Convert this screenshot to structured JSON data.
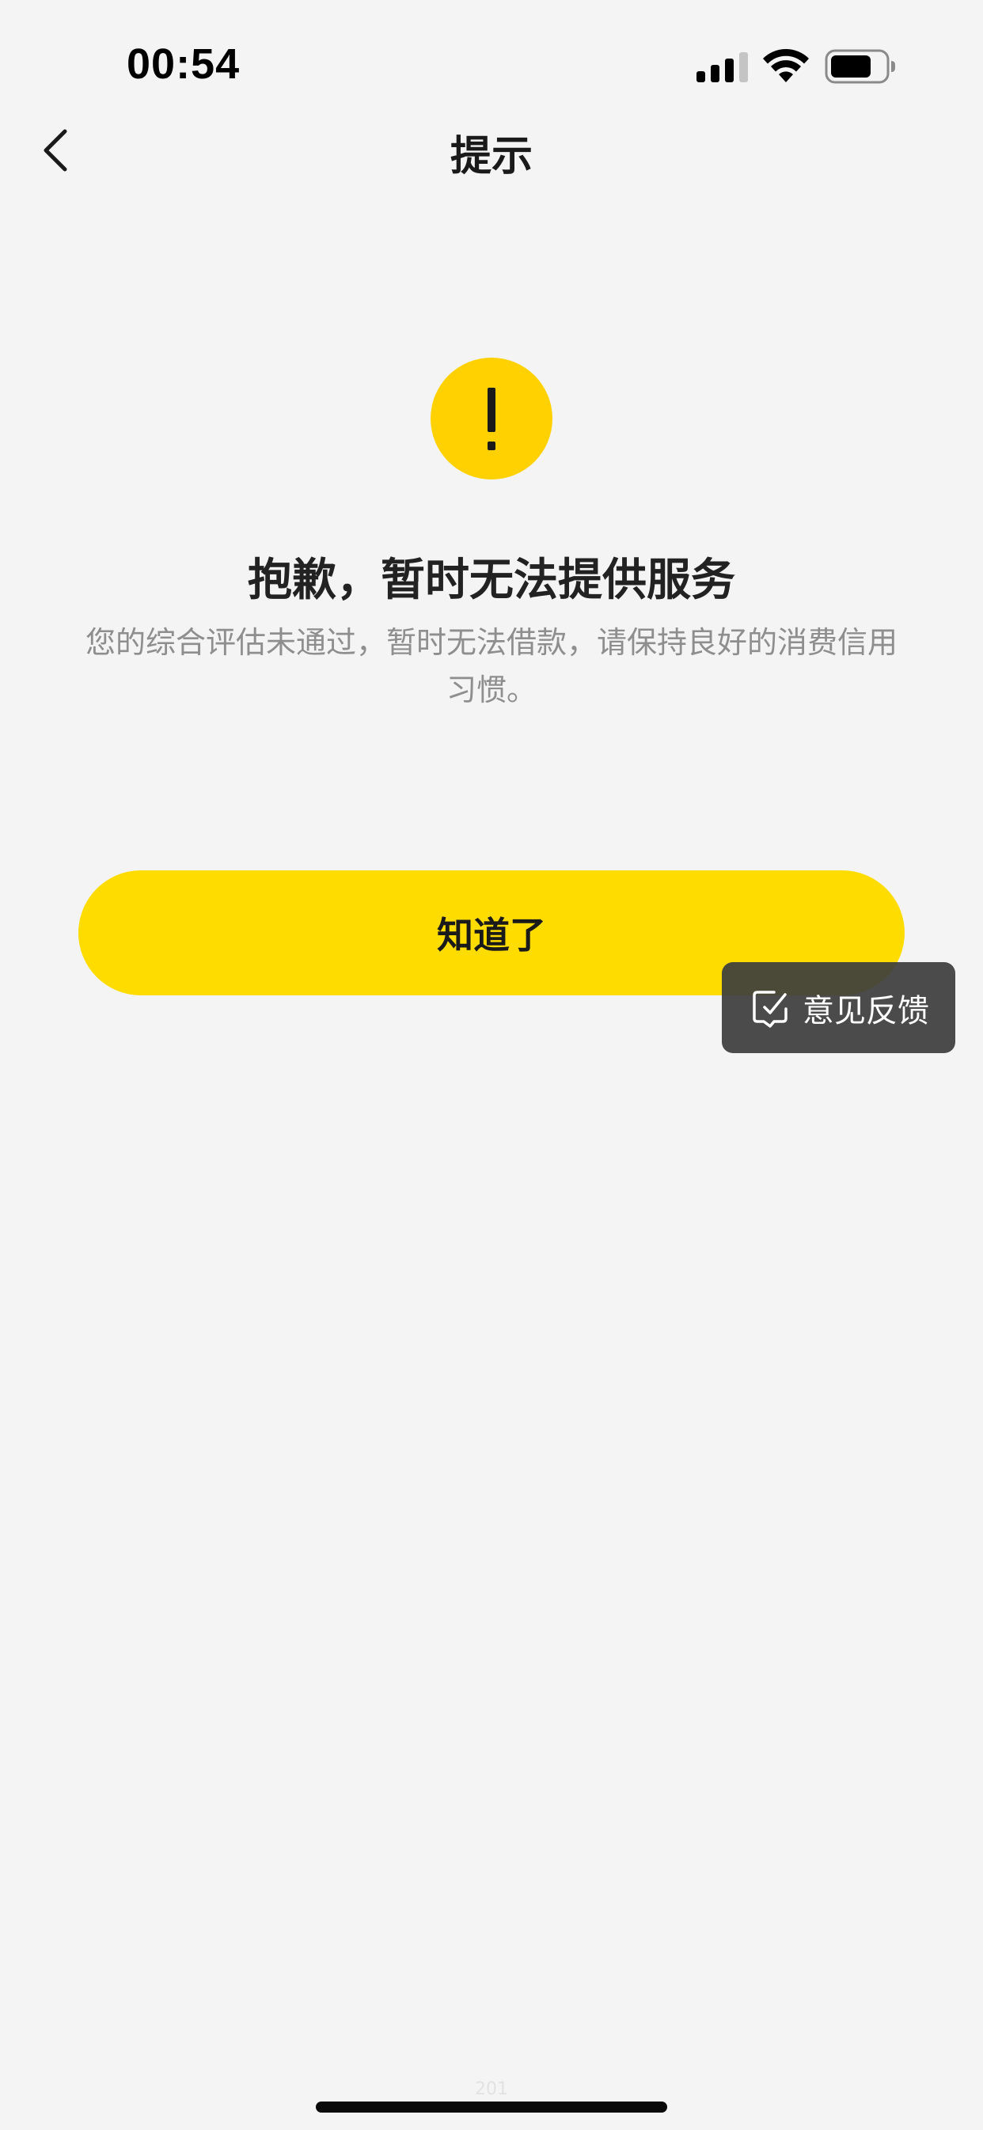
{
  "status_bar": {
    "time": "00:54"
  },
  "nav": {
    "title": "提示"
  },
  "result": {
    "icon_glyph": "!",
    "title": "抱歉，暂时无法提供服务",
    "description": "您的综合评估未通过，暂时无法借款，请保持良好的消费信用习惯。"
  },
  "actions": {
    "confirm_label": "知道了"
  },
  "feedback": {
    "label": "意见反馈"
  },
  "footer": {
    "code": "201"
  },
  "colors": {
    "accent_yellow": "#ffdc00",
    "warning_yellow": "#ffd100",
    "background": "#f4f4f4",
    "feedback_bg": "#3c3c3c"
  },
  "icons": {
    "back": "chevron-left-icon",
    "signal": "cellular-signal-icon",
    "wifi": "wifi-icon",
    "battery": "battery-icon",
    "warning": "exclamation-icon",
    "feedback": "feedback-chat-icon"
  }
}
